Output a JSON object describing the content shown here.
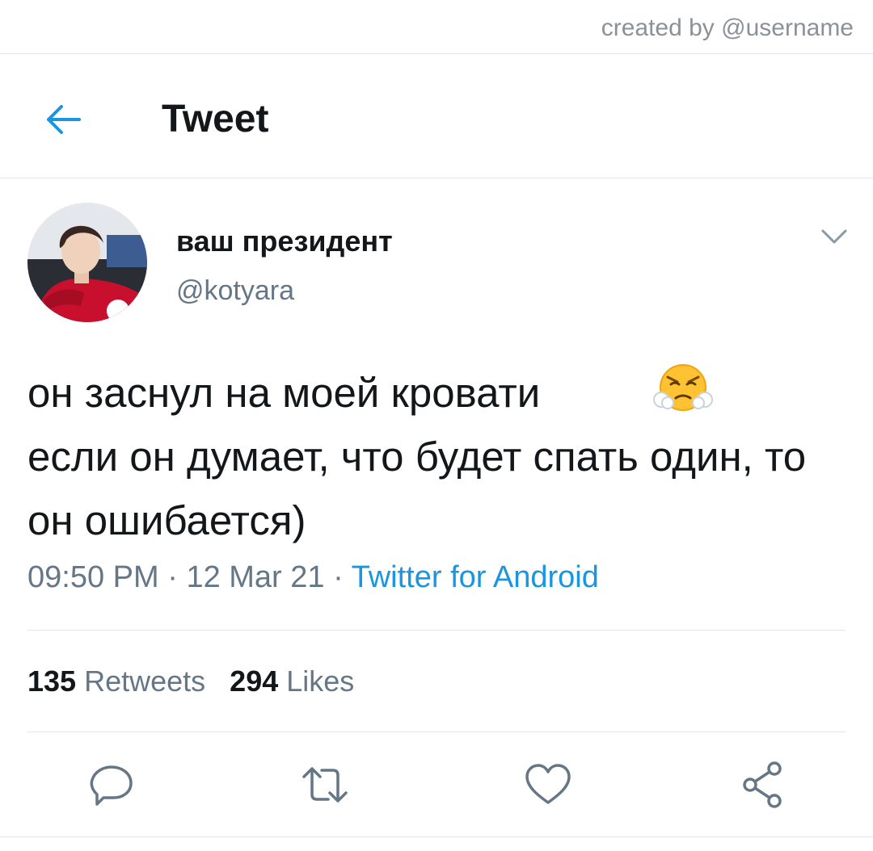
{
  "watermark": "created by @username",
  "header": {
    "title": "Tweet",
    "back_icon": "arrow-left-icon"
  },
  "author": {
    "display_name": "ваш президент",
    "handle": "@kotyara",
    "avatar": "user-avatar-photo"
  },
  "tweet": {
    "text": "он заснул на моей кровати\nесли он думает, что будет спать один, то он ошибается)",
    "emoji": "face-with-steam-from-nose",
    "time": "09:50 PM",
    "date": "12 Mar 21",
    "separator": "·",
    "source": "Twitter for Android"
  },
  "stats": {
    "retweets_count": "135",
    "retweets_label": "Retweets",
    "likes_count": "294",
    "likes_label": "Likes"
  },
  "actions": [
    "reply-icon",
    "retweet-icon",
    "like-icon",
    "share-icon"
  ],
  "colors": {
    "accent": "#1b95e0",
    "muted": "#657786",
    "text": "#14171a",
    "divider": "#e1e5e9"
  }
}
